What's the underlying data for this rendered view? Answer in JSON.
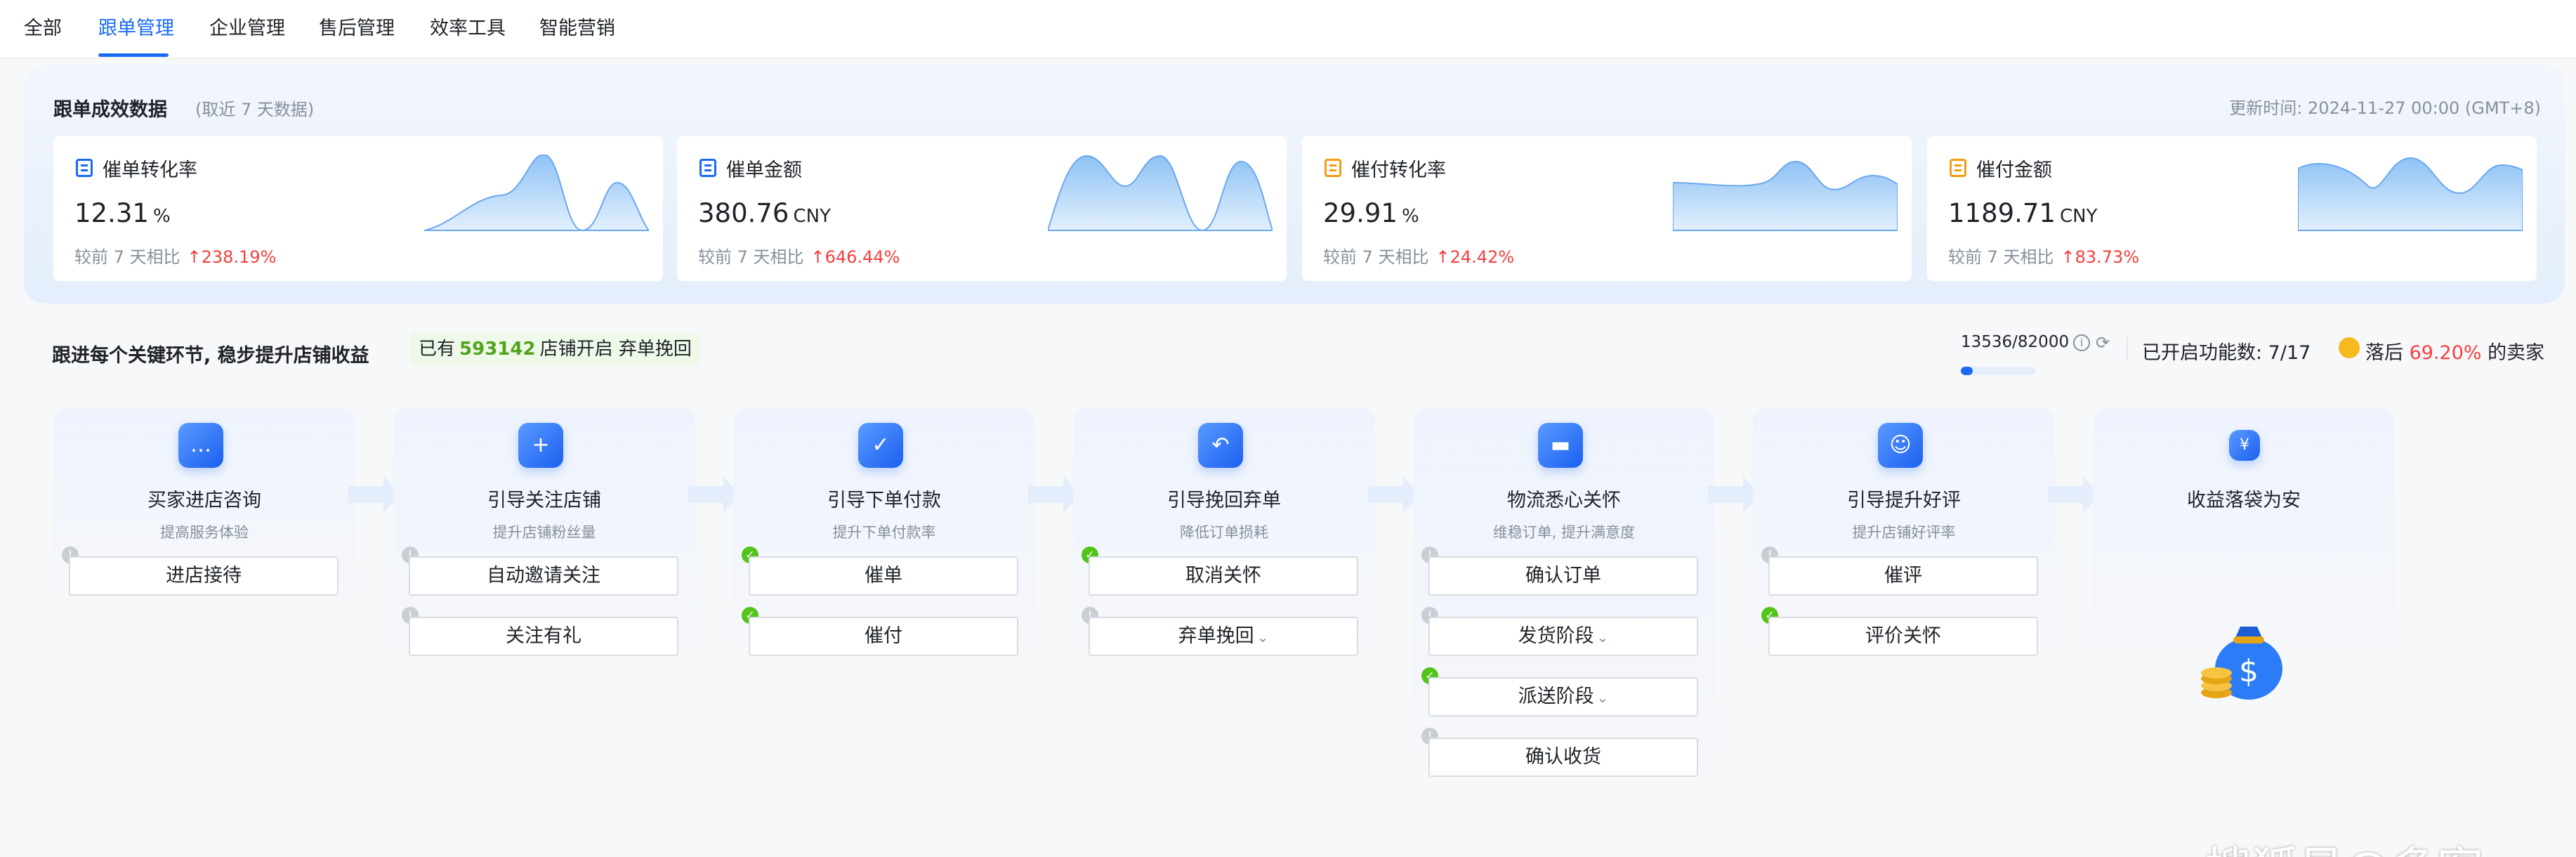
{
  "nav": {
    "tabs": [
      "全部",
      "跟单管理",
      "企业管理",
      "售后管理",
      "效率工具",
      "智能营销"
    ],
    "active_index": 1
  },
  "stats": {
    "title": "跟单成效数据",
    "subtitle": "(取近 7 天数据)",
    "updated": "更新时间: 2024-11-27 00:00 (GMT+8)",
    "cards": [
      {
        "label": "催单转化率",
        "value": "12.31",
        "unit": "%",
        "compare": "较前 7 天相比",
        "change": "↑238.19%",
        "icon": "document-icon"
      },
      {
        "label": "催单金额",
        "value": "380.76",
        "unit": "CNY",
        "compare": "较前 7 天相比",
        "change": "↑646.44%",
        "icon": "document-icon"
      },
      {
        "label": "催付转化率",
        "value": "29.91",
        "unit": "%",
        "compare": "较前 7 天相比",
        "change": "↑24.42%",
        "icon": "wallet-icon"
      },
      {
        "label": "催付金额",
        "value": "1189.71",
        "unit": "CNY",
        "compare": "较前 7 天相比",
        "change": "↑83.73%",
        "icon": "wallet-icon"
      }
    ]
  },
  "funnel": {
    "title": "跟进每个关键环节, 稳步提升店铺收益",
    "badge_prefix": "已有",
    "badge_count": "593142",
    "badge_suffix": "店铺开启 弃单挽回",
    "progress_text": "13536/82000",
    "progress_fraction": 0.165,
    "enabled_label": "已开启功能数: 7/17",
    "behind_prefix": "落后",
    "behind_pct": "69.20%",
    "behind_suffix": "的卖家"
  },
  "steps": [
    {
      "title": "买家进店咨询",
      "sub": "提高服务体验",
      "icon": "chat-icon",
      "actions": [
        {
          "label": "进店接待",
          "enabled": false
        }
      ]
    },
    {
      "title": "引导关注店铺",
      "sub": "提升店铺粉丝量",
      "icon": "store-follow-icon",
      "actions": [
        {
          "label": "自动邀请关注",
          "enabled": false
        },
        {
          "label": "关注有礼",
          "enabled": false
        }
      ]
    },
    {
      "title": "引导下单付款",
      "sub": "提升下单付款率",
      "icon": "checklist-icon",
      "actions": [
        {
          "label": "催单",
          "enabled": true
        },
        {
          "label": "催付",
          "enabled": true
        }
      ]
    },
    {
      "title": "引导挽回弃单",
      "sub": "降低订单损耗",
      "icon": "undo-document-icon",
      "actions": [
        {
          "label": "取消关怀",
          "enabled": true
        },
        {
          "label": "弃单挽回",
          "enabled": false,
          "dropdown": true
        }
      ]
    },
    {
      "title": "物流悉心关怀",
      "sub": "维稳订单, 提升满意度",
      "icon": "truck-icon",
      "actions": [
        {
          "label": "确认订单",
          "enabled": false
        },
        {
          "label": "发货阶段",
          "enabled": false,
          "dropdown": true
        },
        {
          "label": "派送阶段",
          "enabled": true,
          "dropdown": true
        },
        {
          "label": "确认收货",
          "enabled": false
        }
      ]
    },
    {
      "title": "引导提升好评",
      "sub": "提升店铺好评率",
      "icon": "smile-icon",
      "actions": [
        {
          "label": "催评",
          "enabled": false
        },
        {
          "label": "评价关怀",
          "enabled": true
        }
      ]
    },
    {
      "title": "收益落袋为安",
      "sub": "",
      "icon": "money-bag-icon",
      "actions": []
    }
  ],
  "watermark": "搜狐号@多客",
  "colors": {
    "primary": "#1b6af5",
    "success": "#52c41a",
    "up": "#f53f3f",
    "muted": "#86909c"
  }
}
